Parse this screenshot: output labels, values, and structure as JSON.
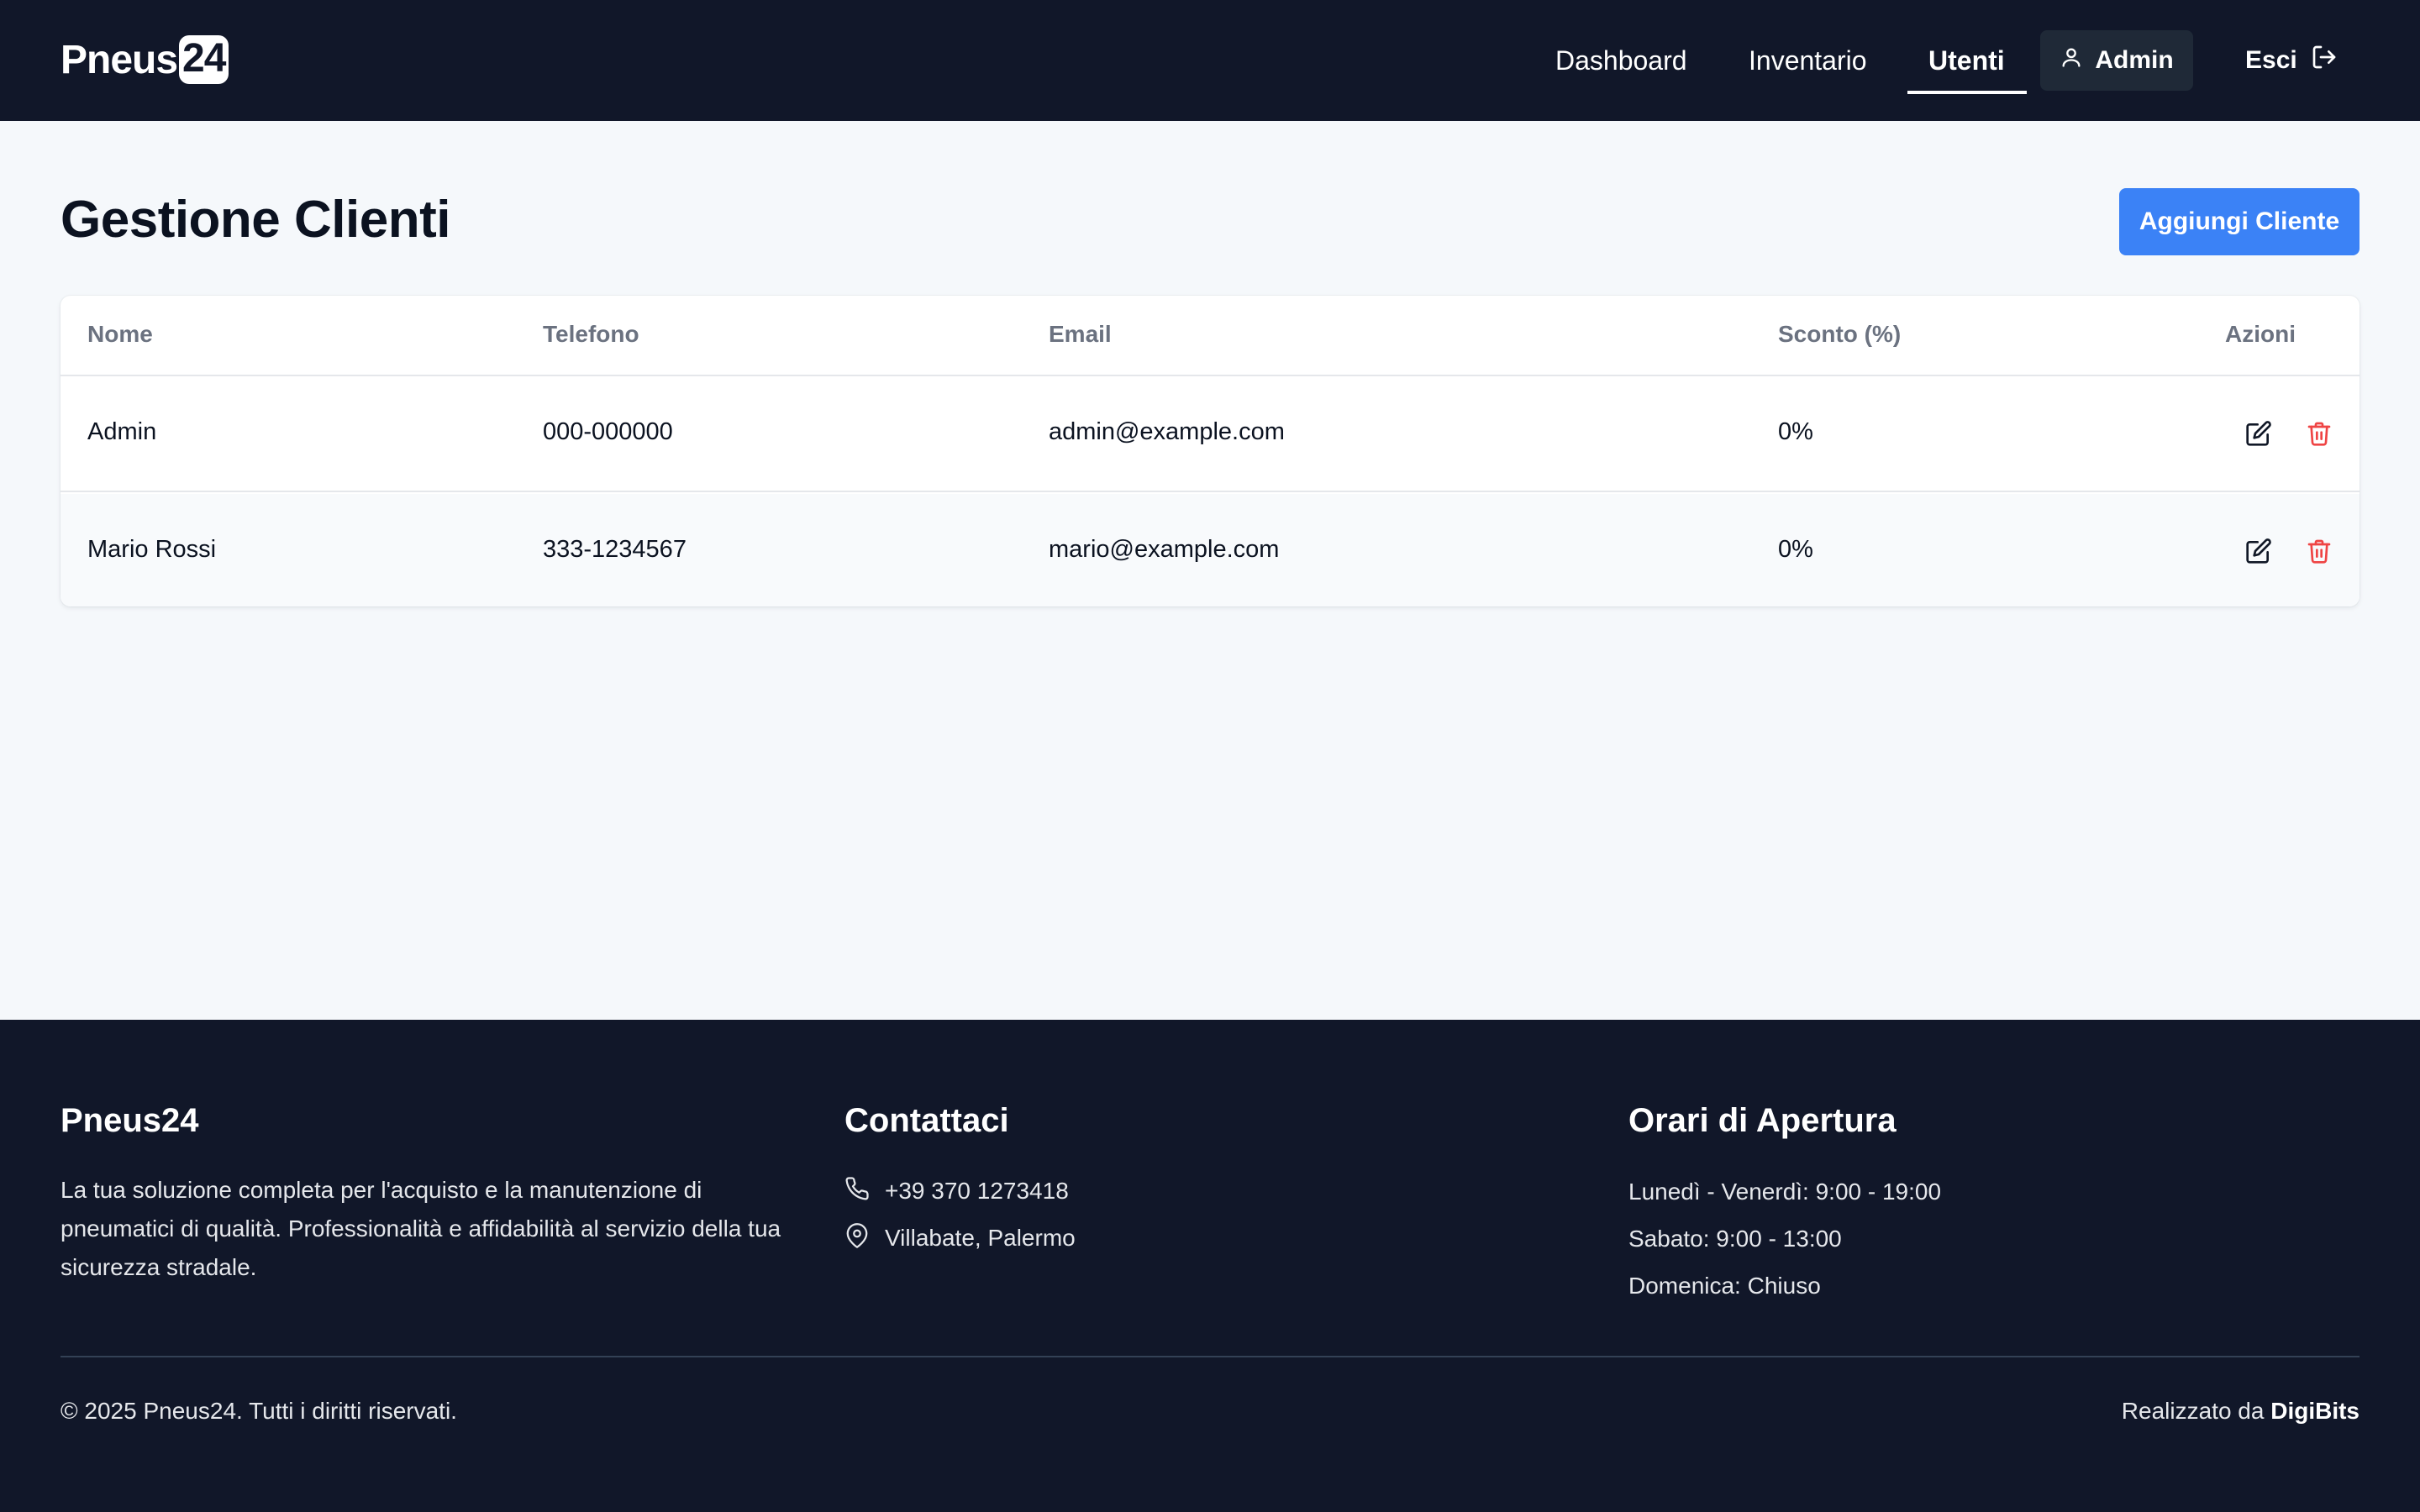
{
  "brand": {
    "name_prefix": "Pneus",
    "name_badge": "24"
  },
  "nav": {
    "items": [
      {
        "label": "Dashboard"
      },
      {
        "label": "Inventario"
      },
      {
        "label": "Utenti",
        "active": true
      }
    ],
    "user_label": "Admin",
    "logout_label": "Esci"
  },
  "page": {
    "title": "Gestione Clienti",
    "add_button_label": "Aggiungi Cliente"
  },
  "table": {
    "columns": [
      "Nome",
      "Telefono",
      "Email",
      "Sconto (%)",
      "Azioni"
    ],
    "rows": [
      {
        "nome": "Admin",
        "telefono": "000-000000",
        "email": "admin@example.com",
        "sconto": "0%"
      },
      {
        "nome": "Mario Rossi",
        "telefono": "333-1234567",
        "email": "mario@example.com",
        "sconto": "0%"
      }
    ]
  },
  "footer": {
    "brand_title": "Pneus24",
    "description": "La tua soluzione completa per l'acquisto e la manutenzione di pneumatici di qualità. Professionalità e affidabilità al servizio della tua sicurezza stradale.",
    "contact_title": "Contattaci",
    "phone": "+39 370 1273418",
    "address": "Villabate, Palermo",
    "hours_title": "Orari di Apertura",
    "hours": [
      "Lunedì - Venerdì: 9:00 - 19:00",
      "Sabato: 9:00 - 13:00",
      "Domenica: Chiuso"
    ],
    "copyright": "© 2025 Pneus24. Tutti i diritti riservati.",
    "credits_prefix": "Realizzato da",
    "credits_name": "DigiBits"
  },
  "colors": {
    "header_bg": "#111729",
    "accent": "#3b82f6",
    "delete": "#ef4444",
    "page_bg": "#f5f8fb"
  },
  "icons": [
    "user-icon",
    "logout-icon",
    "edit-icon",
    "trash-icon",
    "phone-icon",
    "map-pin-icon"
  ]
}
